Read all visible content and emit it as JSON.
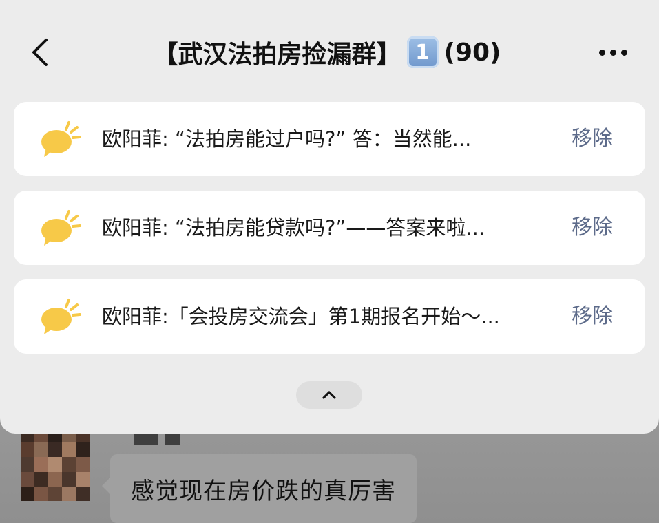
{
  "header": {
    "back_icon": "chevron-left-icon",
    "title": "【武汉法拍房捡漏群】",
    "badge": "1",
    "member_count": "(90)",
    "more_icon": "ellipsis-icon"
  },
  "announcements": [
    {
      "icon": "chat-bubble-icon",
      "text": "欧阳菲: “法拍房能过户吗?” 答：当然能...",
      "remove_label": "移除"
    },
    {
      "icon": "chat-bubble-icon",
      "text": "欧阳菲: “法拍房能贷款吗?”——答案来啦...",
      "remove_label": "移除"
    },
    {
      "icon": "chat-bubble-icon",
      "text": "欧阳菲:「会投房交流会」第1期报名开始～...",
      "remove_label": "移除"
    }
  ],
  "collapse_icon": "chevron-up-icon",
  "chat": {
    "message": "感觉现在房价跌的真厉害"
  },
  "colors": {
    "accent_yellow": "#f7c948",
    "remove_text": "#5d6b8a",
    "sheet_bg": "#ececec",
    "badge_blue": "#7ea6d8"
  }
}
